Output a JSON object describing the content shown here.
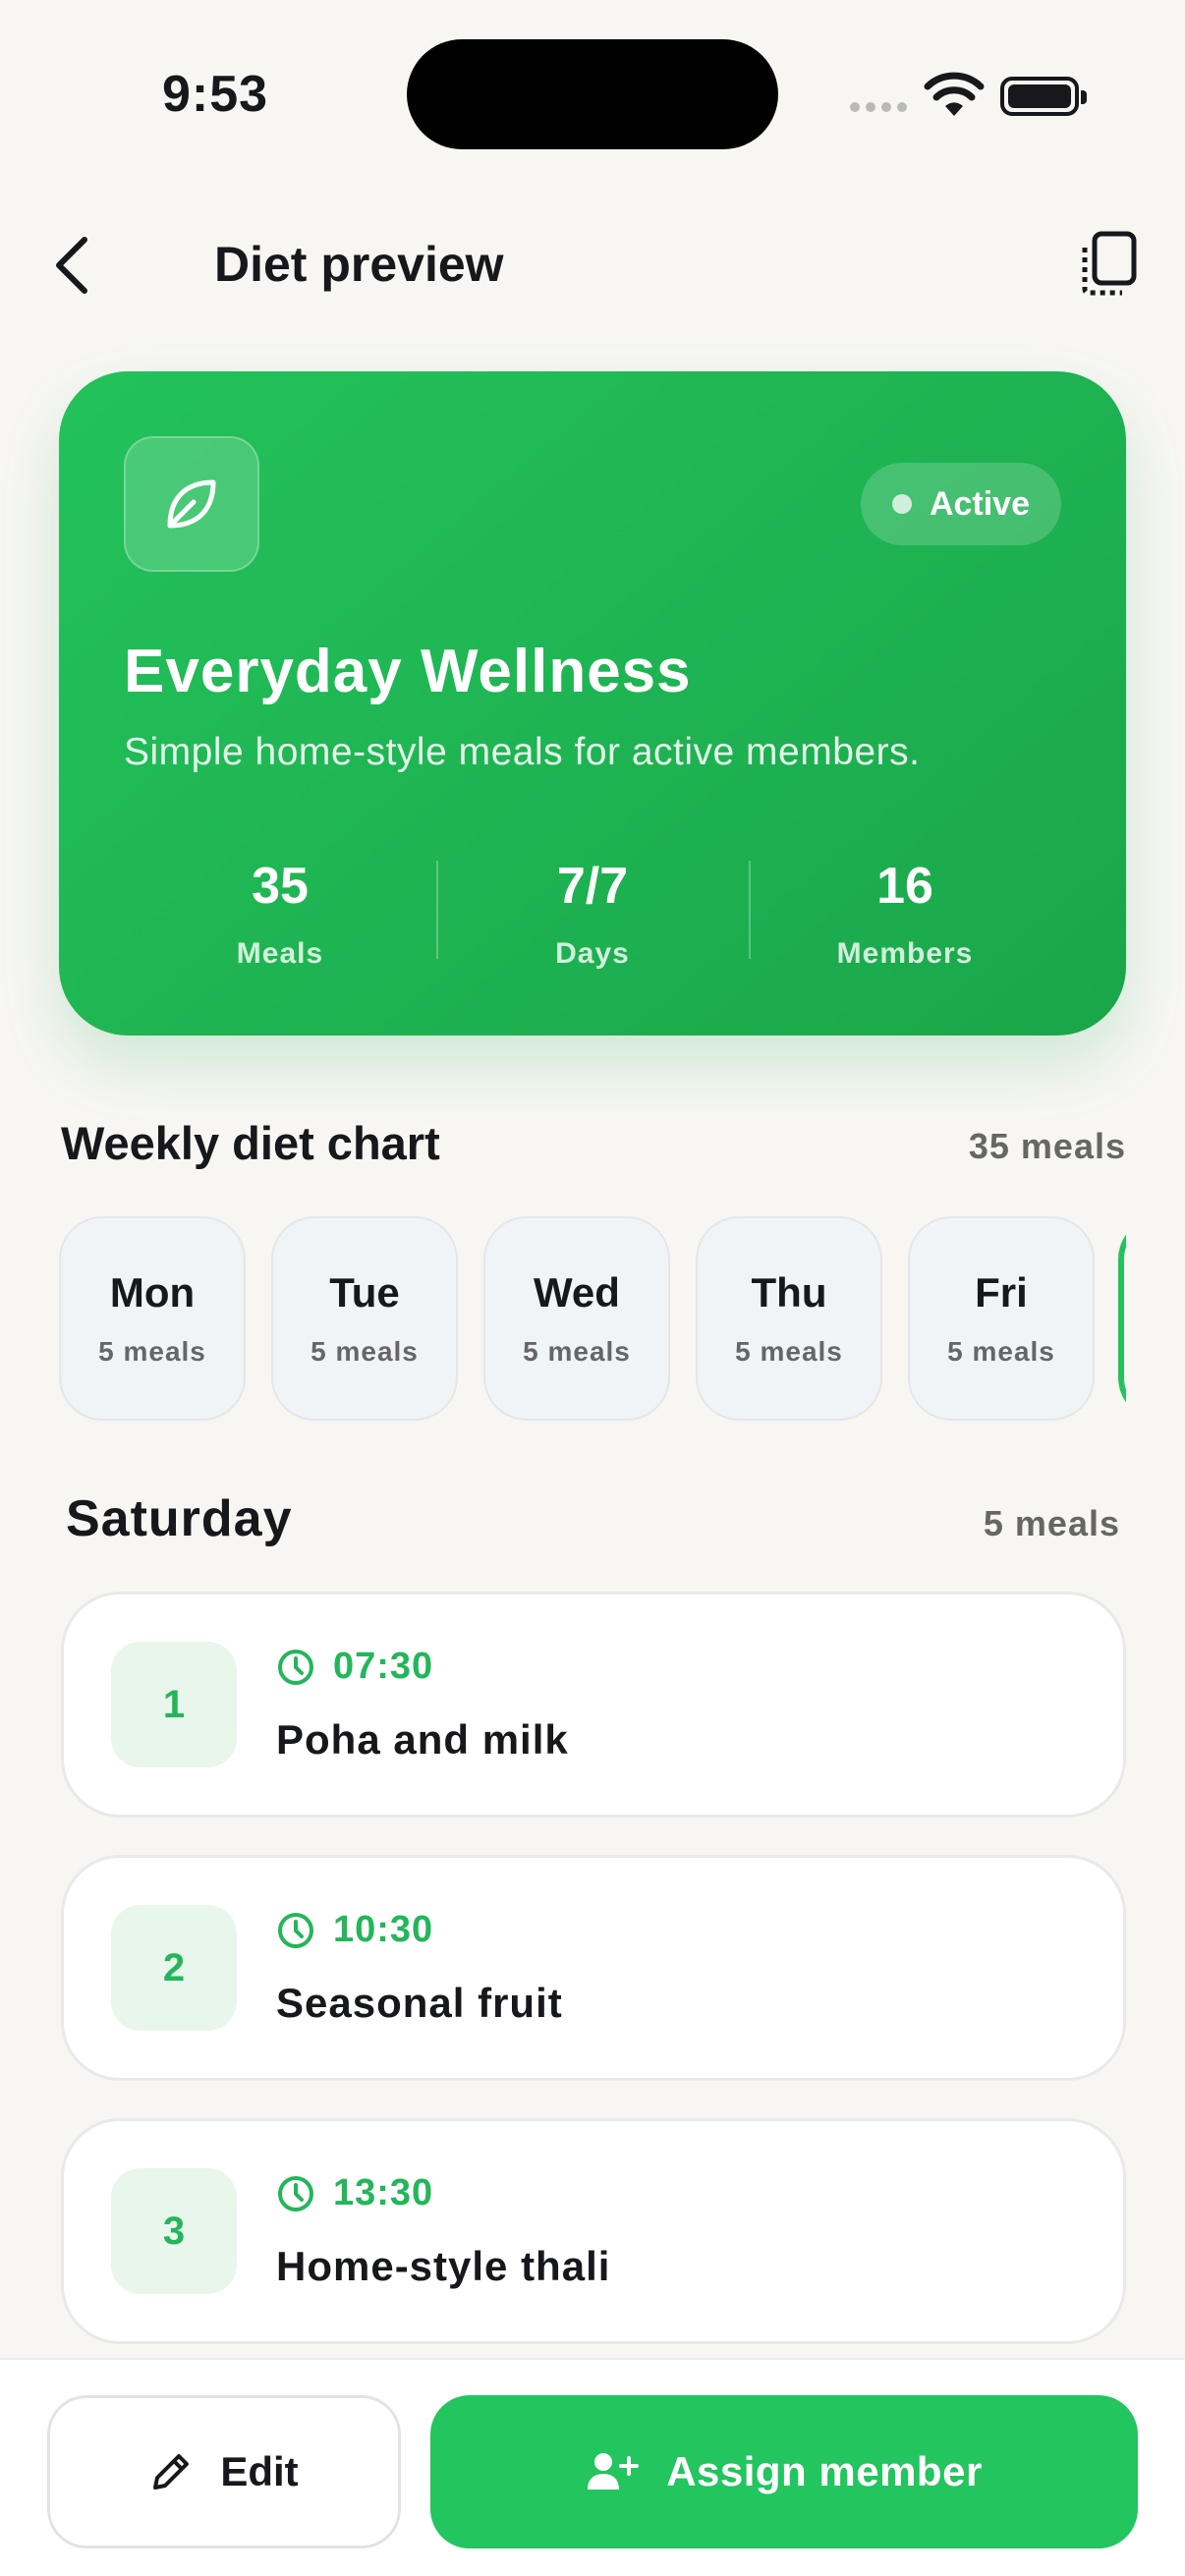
{
  "status_bar": {
    "time": "9:53"
  },
  "header": {
    "title": "Diet preview"
  },
  "plan": {
    "status": "Active",
    "name": "Everyday Wellness",
    "description": "Simple home-style meals for active members.",
    "stats": [
      {
        "value": "35",
        "label": "Meals"
      },
      {
        "value": "7/7",
        "label": "Days"
      },
      {
        "value": "16",
        "label": "Members"
      }
    ]
  },
  "weekly": {
    "title": "Weekly diet chart",
    "count": "35 meals",
    "days": [
      {
        "name": "Mon",
        "meals": "5 meals"
      },
      {
        "name": "Tue",
        "meals": "5 meals"
      },
      {
        "name": "Wed",
        "meals": "5 meals"
      },
      {
        "name": "Thu",
        "meals": "5 meals"
      },
      {
        "name": "Fri",
        "meals": "5 meals"
      }
    ]
  },
  "selected_day": {
    "title": "Saturday",
    "count": "5 meals",
    "meals": [
      {
        "num": "1",
        "time": "07:30",
        "name": "Poha and milk"
      },
      {
        "num": "2",
        "time": "10:30",
        "name": "Seasonal fruit"
      },
      {
        "num": "3",
        "time": "13:30",
        "name": "Home-style thali"
      }
    ]
  },
  "actions": {
    "edit": "Edit",
    "assign": "Assign member"
  },
  "colors": {
    "accent": "#22c55e",
    "background": "#f7f6f3"
  }
}
